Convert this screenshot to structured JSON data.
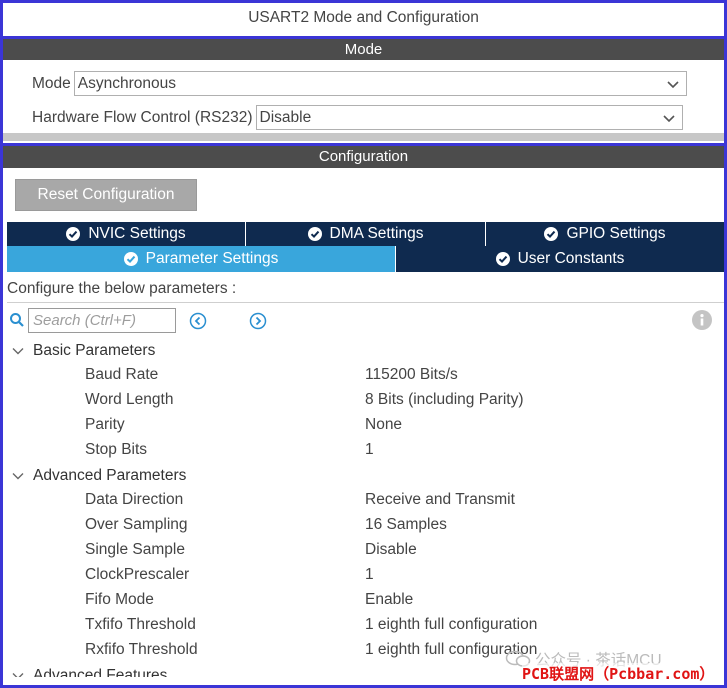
{
  "window": {
    "title": "USART2 Mode and Configuration"
  },
  "mode_section": {
    "title": "Mode",
    "mode_label": "Mode",
    "mode_value": "Asynchronous",
    "flow_label": "Hardware Flow Control (RS232)",
    "flow_value": "Disable"
  },
  "config_section": {
    "title": "Configuration",
    "reset_button": "Reset Configuration"
  },
  "tabs": {
    "nvic": "NVIC Settings",
    "dma": "DMA Settings",
    "gpio": "GPIO Settings",
    "parameter": "Parameter Settings",
    "user_constants": "User Constants"
  },
  "configure_text": "Configure the below parameters :",
  "search": {
    "placeholder": "Search (Ctrl+F)"
  },
  "groups": {
    "basic": {
      "title": "Basic Parameters",
      "params": [
        {
          "name": "Baud Rate",
          "value": "115200 Bits/s"
        },
        {
          "name": "Word Length",
          "value": "8 Bits (including Parity)"
        },
        {
          "name": "Parity",
          "value": "None"
        },
        {
          "name": "Stop Bits",
          "value": "1"
        }
      ]
    },
    "advanced": {
      "title": "Advanced Parameters",
      "params": [
        {
          "name": "Data Direction",
          "value": "Receive and Transmit"
        },
        {
          "name": "Over Sampling",
          "value": "16 Samples"
        },
        {
          "name": "Single Sample",
          "value": "Disable"
        },
        {
          "name": "ClockPrescaler",
          "value": "1"
        },
        {
          "name": "Fifo Mode",
          "value": "Enable"
        },
        {
          "name": "Txfifo Threshold",
          "value": "1 eighth full configuration"
        },
        {
          "name": "Rxfifo Threshold",
          "value": "1 eighth full configuration"
        }
      ]
    },
    "advanced_features": {
      "title": "Advanced Features"
    }
  },
  "watermark": {
    "text": "公众号 · 茶话MCU",
    "brand": "PCB联盟网（Pcbbar.com）"
  },
  "colors": {
    "tab_dark": "#0f2a4f",
    "tab_active": "#39a6dc",
    "section_bar": "#4c4c4c",
    "frame": "#3b35d6",
    "brand": "#e01414"
  }
}
